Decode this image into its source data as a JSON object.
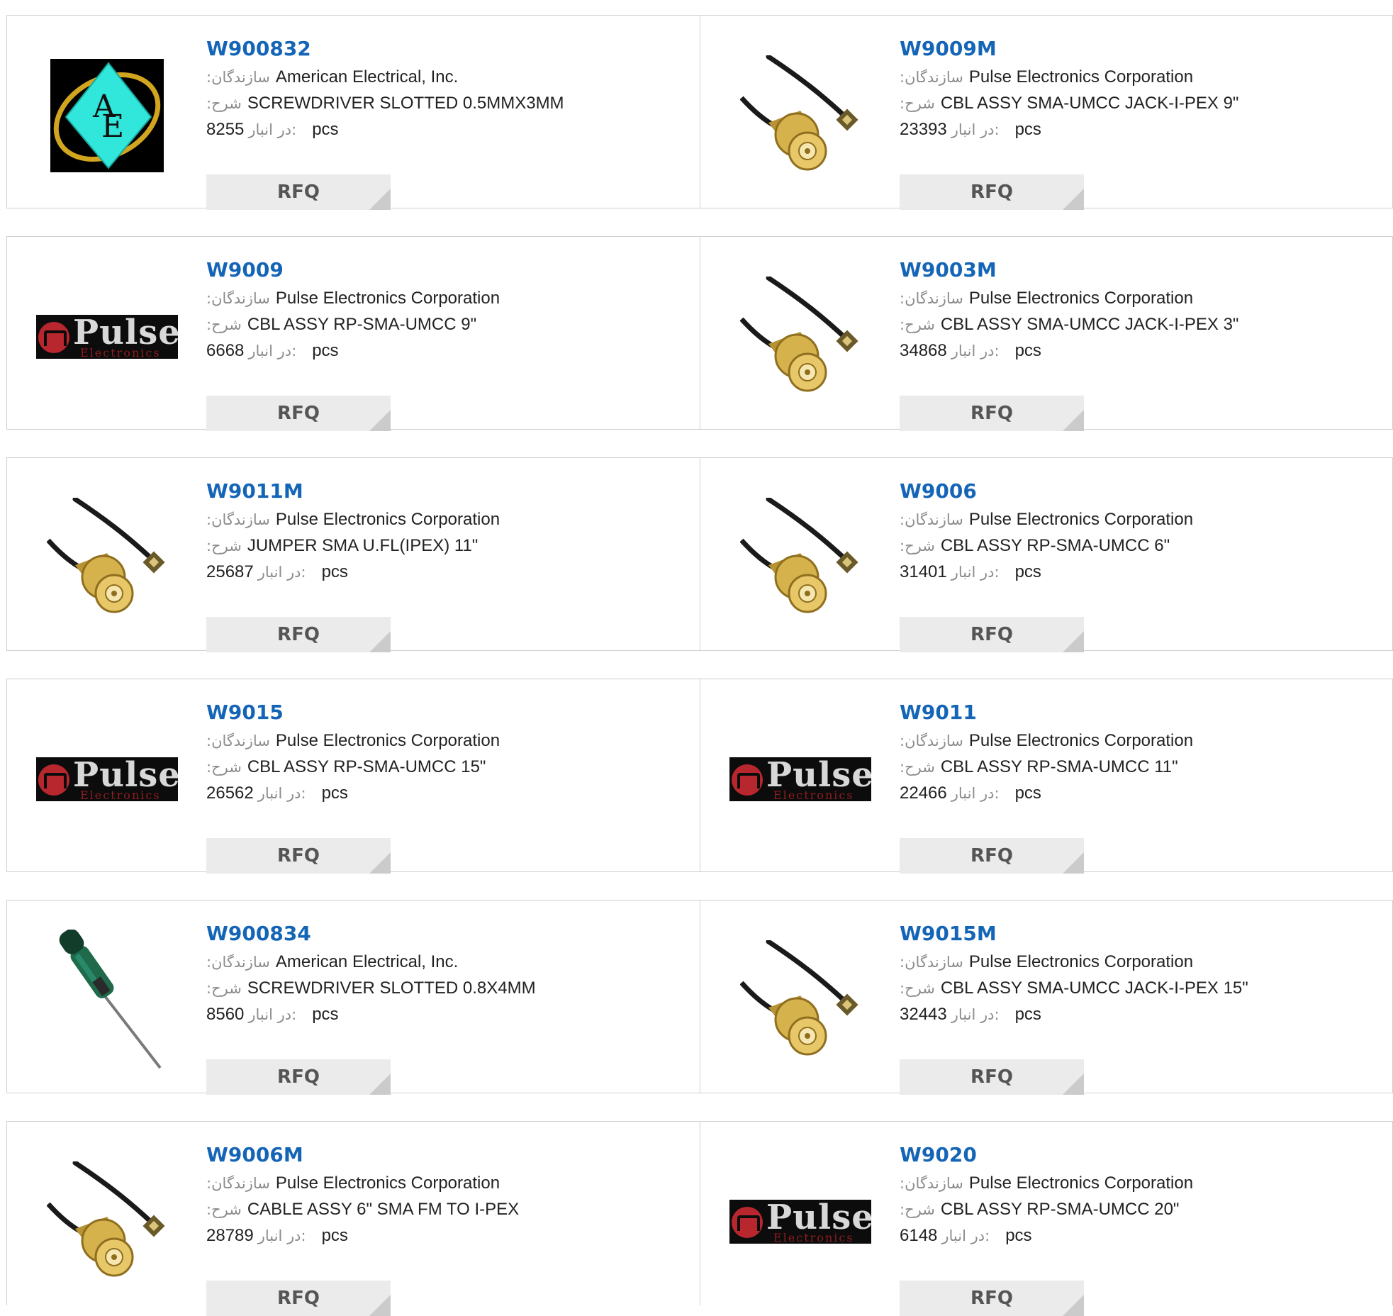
{
  "labels": {
    "manufacturer": ":سازندگان",
    "description": ":شرح",
    "stock": "در انبار:",
    "unit": "pcs",
    "rfq": "RFQ"
  },
  "brand_logo": {
    "pulse_word": "Pulse",
    "pulse_sub": "Electronics"
  },
  "products": [
    {
      "pn": "W900832",
      "manufacturer": "American Electrical, Inc.",
      "description": "SCREWDRIVER SLOTTED 0.5MMX3MM",
      "stock": "8255",
      "image": "ae-logo"
    },
    {
      "pn": "W9009M",
      "manufacturer": "Pulse Electronics Corporation",
      "description": "CBL ASSY SMA-UMCC JACK-I-PEX 9\"",
      "stock": "23393",
      "image": "cable"
    },
    {
      "pn": "W9009",
      "manufacturer": "Pulse Electronics Corporation",
      "description": "CBL ASSY RP-SMA-UMCC 9\"",
      "stock": "6668",
      "image": "pulse-logo"
    },
    {
      "pn": "W9003M",
      "manufacturer": "Pulse Electronics Corporation",
      "description": "CBL ASSY SMA-UMCC JACK-I-PEX 3\"",
      "stock": "34868",
      "image": "cable"
    },
    {
      "pn": "W9011M",
      "manufacturer": "Pulse Electronics Corporation",
      "description": "JUMPER SMA U.FL(IPEX) 11\"",
      "stock": "25687",
      "image": "cable"
    },
    {
      "pn": "W9006",
      "manufacturer": "Pulse Electronics Corporation",
      "description": "CBL ASSY RP-SMA-UMCC 6\"",
      "stock": "31401",
      "image": "cable"
    },
    {
      "pn": "W9015",
      "manufacturer": "Pulse Electronics Corporation",
      "description": "CBL ASSY RP-SMA-UMCC 15\"",
      "stock": "26562",
      "image": "pulse-logo"
    },
    {
      "pn": "W9011",
      "manufacturer": "Pulse Electronics Corporation",
      "description": "CBL ASSY RP-SMA-UMCC 11\"",
      "stock": "22466",
      "image": "pulse-logo"
    },
    {
      "pn": "W900834",
      "manufacturer": "American Electrical, Inc.",
      "description": "SCREWDRIVER SLOTTED 0.8X4MM",
      "stock": "8560",
      "image": "screwdriver"
    },
    {
      "pn": "W9015M",
      "manufacturer": "Pulse Electronics Corporation",
      "description": "CBL ASSY SMA-UMCC JACK-I-PEX 15\"",
      "stock": "32443",
      "image": "cable"
    },
    {
      "pn": "W9006M",
      "manufacturer": "Pulse Electronics Corporation",
      "description": "CABLE ASSY 6\" SMA FM TO I-PEX",
      "stock": "28789",
      "image": "cable"
    },
    {
      "pn": "W9020",
      "manufacturer": "Pulse Electronics Corporation",
      "description": "CBL ASSY RP-SMA-UMCC 20\"",
      "stock": "6148",
      "image": "pulse-logo"
    }
  ],
  "colors": {
    "link": "#1565b7",
    "border": "#cfcfcf",
    "button_bg": "#ebebeb",
    "label": "#8c8c8c"
  }
}
